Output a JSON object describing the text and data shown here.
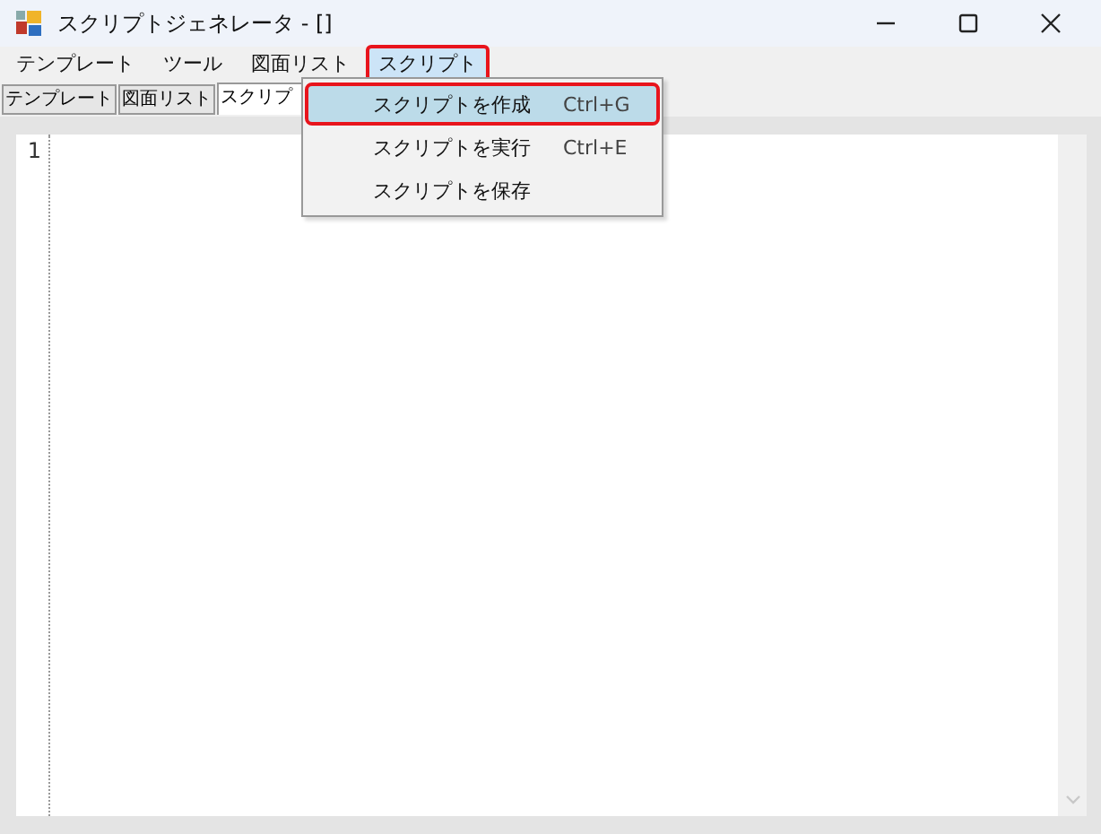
{
  "window": {
    "title": "スクリプトジェネレータ - []"
  },
  "menubar": [
    {
      "label": "テンプレート",
      "selected": false
    },
    {
      "label": "ツール",
      "selected": false
    },
    {
      "label": "図面リスト",
      "selected": false
    },
    {
      "label": "スクリプト",
      "selected": true
    }
  ],
  "tabs": [
    {
      "label": "テンプレート",
      "selected": false
    },
    {
      "label": "図面リスト",
      "selected": false
    },
    {
      "label": "スクリプ",
      "selected": true
    }
  ],
  "menu": {
    "items": [
      {
        "label": "スクリプトを作成",
        "shortcut": "Ctrl+G",
        "selected": true
      },
      {
        "label": "スクリプトを実行",
        "shortcut": "Ctrl+E",
        "selected": false
      },
      {
        "label": "スクリプトを保存",
        "selected": false
      }
    ]
  },
  "editor": {
    "line_numbers": [
      "1"
    ]
  }
}
